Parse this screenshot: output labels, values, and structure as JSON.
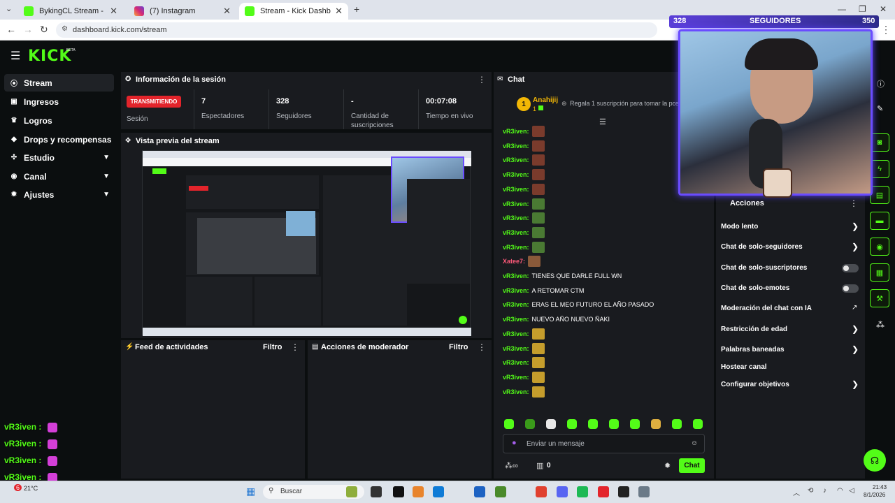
{
  "browser": {
    "tabs": [
      {
        "title": "BykingCL Stream - Watch Live o"
      },
      {
        "title": "(7) Instagram"
      },
      {
        "title": "Stream - Kick Dashboard"
      }
    ],
    "url": "dashboard.kick.com/stream"
  },
  "brand": {
    "logo": "KICK",
    "beta": "BETA",
    "accent": "#53fc18"
  },
  "sidebar": {
    "items": [
      {
        "label": "Stream",
        "icon": "broadcast-icon"
      },
      {
        "label": "Ingresos",
        "icon": "money-icon"
      },
      {
        "label": "Logros",
        "icon": "trophy-icon"
      },
      {
        "label": "Drops y recompensas",
        "icon": "gift-icon"
      },
      {
        "label": "Estudio",
        "icon": "studio-icon"
      },
      {
        "label": "Canal",
        "icon": "channel-icon"
      },
      {
        "label": "Ajustes",
        "icon": "gear-icon"
      }
    ]
  },
  "session": {
    "title": "Información de la sesión",
    "status": "TRANSMITIENDO",
    "session_label": "Sesión",
    "viewers_value": "7",
    "viewers_label": "Espectadores",
    "followers_value": "328",
    "followers_label": "Seguidores",
    "subs_value": "-",
    "subs_label_1": "Cantidad de",
    "subs_label_2": "suscripciones",
    "time_value": "00:07:08",
    "time_label": "Tiempo en vivo"
  },
  "preview": {
    "title": "Vista previa del stream"
  },
  "feed": {
    "title": "Feed de actividades",
    "filter": "Filtro"
  },
  "modactions": {
    "title": "Acciones de moderador",
    "filter": "Filtro"
  },
  "chat": {
    "title": "Chat",
    "pinned_user": "Anahijij",
    "pinned_rank": "1",
    "pinned_sub": "1",
    "gift_text": "Regala 1 suscripción para tomar la posic",
    "input_placeholder": "Enviar un mensaje",
    "points_count": "0",
    "send_label": "Chat",
    "messages": [
      {
        "user": "vR3iven:",
        "text": ""
      },
      {
        "user": "vR3iven:",
        "text": ""
      },
      {
        "user": "vR3iven:",
        "text": ""
      },
      {
        "user": "vR3iven:",
        "text": ""
      },
      {
        "user": "vR3iven:",
        "text": ""
      },
      {
        "user": "vR3iven:",
        "text": ""
      },
      {
        "user": "vR3iven:",
        "text": ""
      },
      {
        "user": "vR3iven:",
        "text": ""
      },
      {
        "user": "vR3iven:",
        "text": ""
      },
      {
        "user": "Xatee7:",
        "text": ""
      },
      {
        "user": "vR3iven:",
        "text": "TIENES QUE DARLE FULL WN"
      },
      {
        "user": "vR3iven:",
        "text": "A RETOMAR CTM"
      },
      {
        "user": "vR3iven:",
        "text": "ERAS EL MEO FUTURO EL AÑO PASADO"
      },
      {
        "user": "vR3iven:",
        "text": "NUEVO AÑO NUEVO ÑAKI"
      },
      {
        "user": "vR3iven:",
        "text": ""
      },
      {
        "user": "vR3iven:",
        "text": ""
      },
      {
        "user": "vR3iven:",
        "text": ""
      },
      {
        "user": "vR3iven:",
        "text": ""
      },
      {
        "user": "vR3iven:",
        "text": ""
      }
    ]
  },
  "mod_menu": {
    "title": "Acciones",
    "items": [
      {
        "label": "Modo lento",
        "control": "chevron"
      },
      {
        "label": "Chat de solo-seguidores",
        "control": "chevron"
      },
      {
        "label": "Chat de solo-suscriptores",
        "control": "toggle"
      },
      {
        "label": "Chat de solo-emotes",
        "control": "toggle"
      },
      {
        "label": "Moderación del chat con IA",
        "control": "external"
      },
      {
        "label": "Restricción de edad",
        "control": "chevron"
      },
      {
        "label": "Palabras baneadas",
        "control": "chevron"
      },
      {
        "label": "Hostear canal",
        "control": "none"
      },
      {
        "label": "Configurar objetivos",
        "control": "chevron"
      }
    ]
  },
  "overlay": {
    "followers_current": "328",
    "followers_label": "SEGUIDORES",
    "followers_goal": "350",
    "chat_overlay": [
      "vR3iven :",
      "vR3iven :",
      "vR3iven :",
      "vR3iven :",
      "vR3iven :"
    ]
  },
  "taskbar": {
    "search": "Buscar",
    "time": "21:43",
    "date": "8/1/2026",
    "weather": "21°C",
    "weather_badge": "6"
  }
}
